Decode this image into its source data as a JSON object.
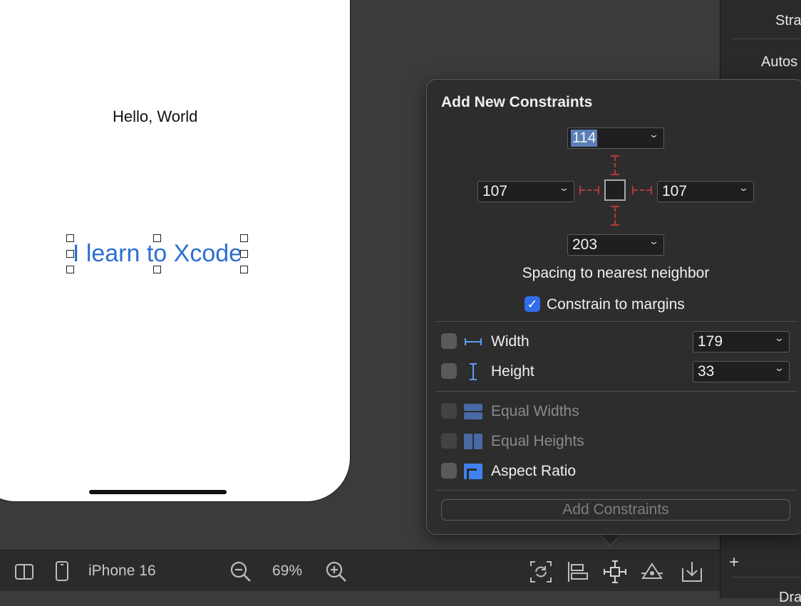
{
  "canvas": {
    "hello_label": "Hello, World",
    "selected_label": "I learn to Xcode"
  },
  "inspector": {
    "row1": "Stra",
    "row2": "Autos",
    "row3": "Dra"
  },
  "popover": {
    "title": "Add New Constraints",
    "spacing": {
      "top": "114",
      "left": "107",
      "right": "107",
      "bottom": "203"
    },
    "spacing_label": "Spacing to nearest neighbor",
    "constrain_to_margins": {
      "label": "Constrain to margins",
      "checked": true
    },
    "width": {
      "label": "Width",
      "value": "179",
      "checked": false
    },
    "height": {
      "label": "Height",
      "value": "33",
      "checked": false
    },
    "equal_widths": {
      "label": "Equal Widths",
      "enabled": false
    },
    "equal_heights": {
      "label": "Equal Heights",
      "enabled": false
    },
    "aspect_ratio": {
      "label": "Aspect Ratio",
      "checked": false
    },
    "add_button": "Add Constraints"
  },
  "toolbar": {
    "device": "iPhone 16",
    "zoom": "69%"
  },
  "colors": {
    "accent": "#2f6ee8",
    "label_text": "#2c6fd1",
    "constraint_red": "#b23a3a",
    "popover_bg": "#2d2d2d"
  }
}
